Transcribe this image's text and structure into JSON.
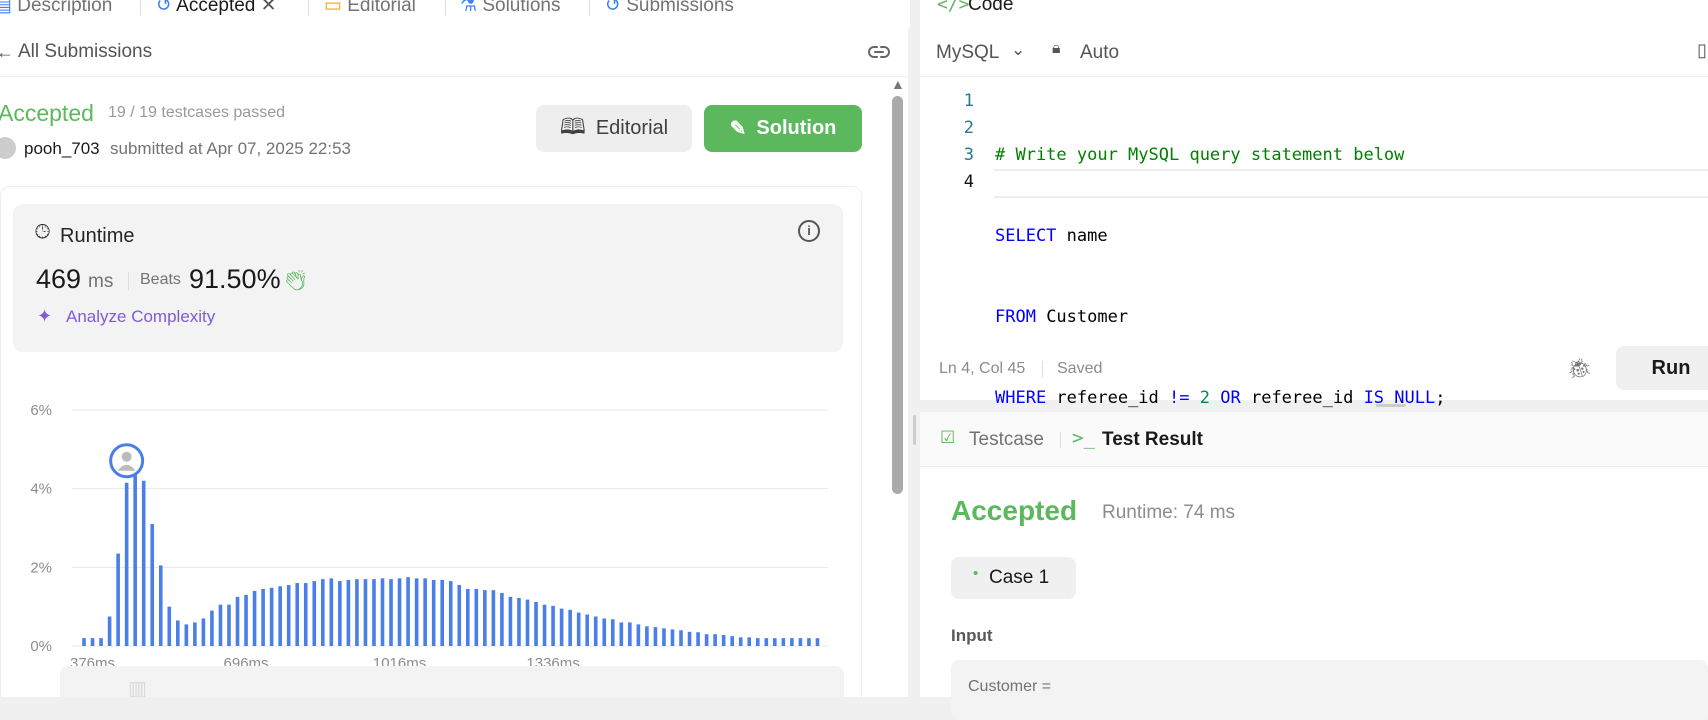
{
  "tabs": [
    {
      "label": "Description"
    },
    {
      "label": "Accepted"
    },
    {
      "label": "Editorial"
    },
    {
      "label": "Solutions"
    },
    {
      "label": "Submissions"
    }
  ],
  "code_tab": {
    "label": "Code"
  },
  "submission_nav": {
    "back_label": "All Submissions"
  },
  "submission": {
    "status": "Accepted",
    "testcases": "19 / 19 testcases passed",
    "username": "pooh_703",
    "submitted_text": "submitted at Apr 07, 2025 22:53",
    "editorial_button": "Editorial",
    "solution_button": "Solution"
  },
  "runtime": {
    "title": "Runtime",
    "value": "469",
    "unit": "ms",
    "beats_label": "Beats",
    "beats_value": "91.50%",
    "analyze_label": "Analyze Complexity"
  },
  "chart_data": {
    "type": "bar",
    "title": "",
    "xlabel": "",
    "ylabel": "",
    "ylim": [
      0,
      6
    ],
    "y_tick_labels": [
      "6%",
      "4%",
      "2%",
      "0%"
    ],
    "y_ticks": [
      6,
      4,
      2,
      0
    ],
    "x_tick_labels": [
      "376ms",
      "696ms",
      "1016ms",
      "1336ms"
    ],
    "x_ticks_index": [
      1,
      19,
      37,
      55
    ],
    "highlight_index": 5,
    "values": [
      0.2,
      0.2,
      0.2,
      0.75,
      2.35,
      4.15,
      4.6,
      4.2,
      3.1,
      2.05,
      1.0,
      0.65,
      0.55,
      0.6,
      0.7,
      0.9,
      1.05,
      1.05,
      1.25,
      1.3,
      1.4,
      1.45,
      1.48,
      1.52,
      1.55,
      1.6,
      1.6,
      1.65,
      1.7,
      1.72,
      1.65,
      1.68,
      1.7,
      1.7,
      1.7,
      1.72,
      1.7,
      1.72,
      1.75,
      1.72,
      1.72,
      1.68,
      1.68,
      1.65,
      1.55,
      1.45,
      1.45,
      1.42,
      1.42,
      1.35,
      1.25,
      1.22,
      1.18,
      1.12,
      1.05,
      1.02,
      0.95,
      0.92,
      0.85,
      0.8,
      0.75,
      0.7,
      0.68,
      0.6,
      0.6,
      0.55,
      0.5,
      0.48,
      0.45,
      0.42,
      0.4,
      0.36,
      0.35,
      0.3,
      0.3,
      0.28,
      0.25,
      0.22,
      0.22,
      0.2,
      0.2,
      0.2,
      0.2,
      0.2,
      0.2,
      0.2,
      0.2
    ]
  },
  "editor": {
    "language": "MySQL",
    "auto_label": "Auto",
    "line_numbers": [
      "1",
      "2",
      "3",
      "4"
    ],
    "status_position": "Ln 4, Col 45",
    "status_saved": "Saved",
    "run_label": "Run"
  },
  "code_lines": {
    "l1": "# Write your MySQL query statement below",
    "l2_kw": "SELECT",
    "l2_rest": " name",
    "l3_kw": "FROM",
    "l3_rest": " Customer",
    "l4_kw1": "WHERE",
    "l4_t1": " referee_id ",
    "l4_op": "!=",
    "l4_sp": " ",
    "l4_num": "2",
    "l4_sp2": " ",
    "l4_kw2": "OR",
    "l4_t2": " referee_id ",
    "l4_kw3": "IS NULL",
    "l4_end": ";"
  },
  "result": {
    "testcase_tab": "Testcase",
    "result_tab": "Test Result",
    "status": "Accepted",
    "runtime_text": "Runtime: 74 ms",
    "case_label": "Case 1",
    "input_label": "Input",
    "input_value": "Customer ="
  },
  "colors": {
    "accepted": "#5cb85c",
    "bar": "#4a7ee8",
    "link": "#7c5cd6"
  }
}
